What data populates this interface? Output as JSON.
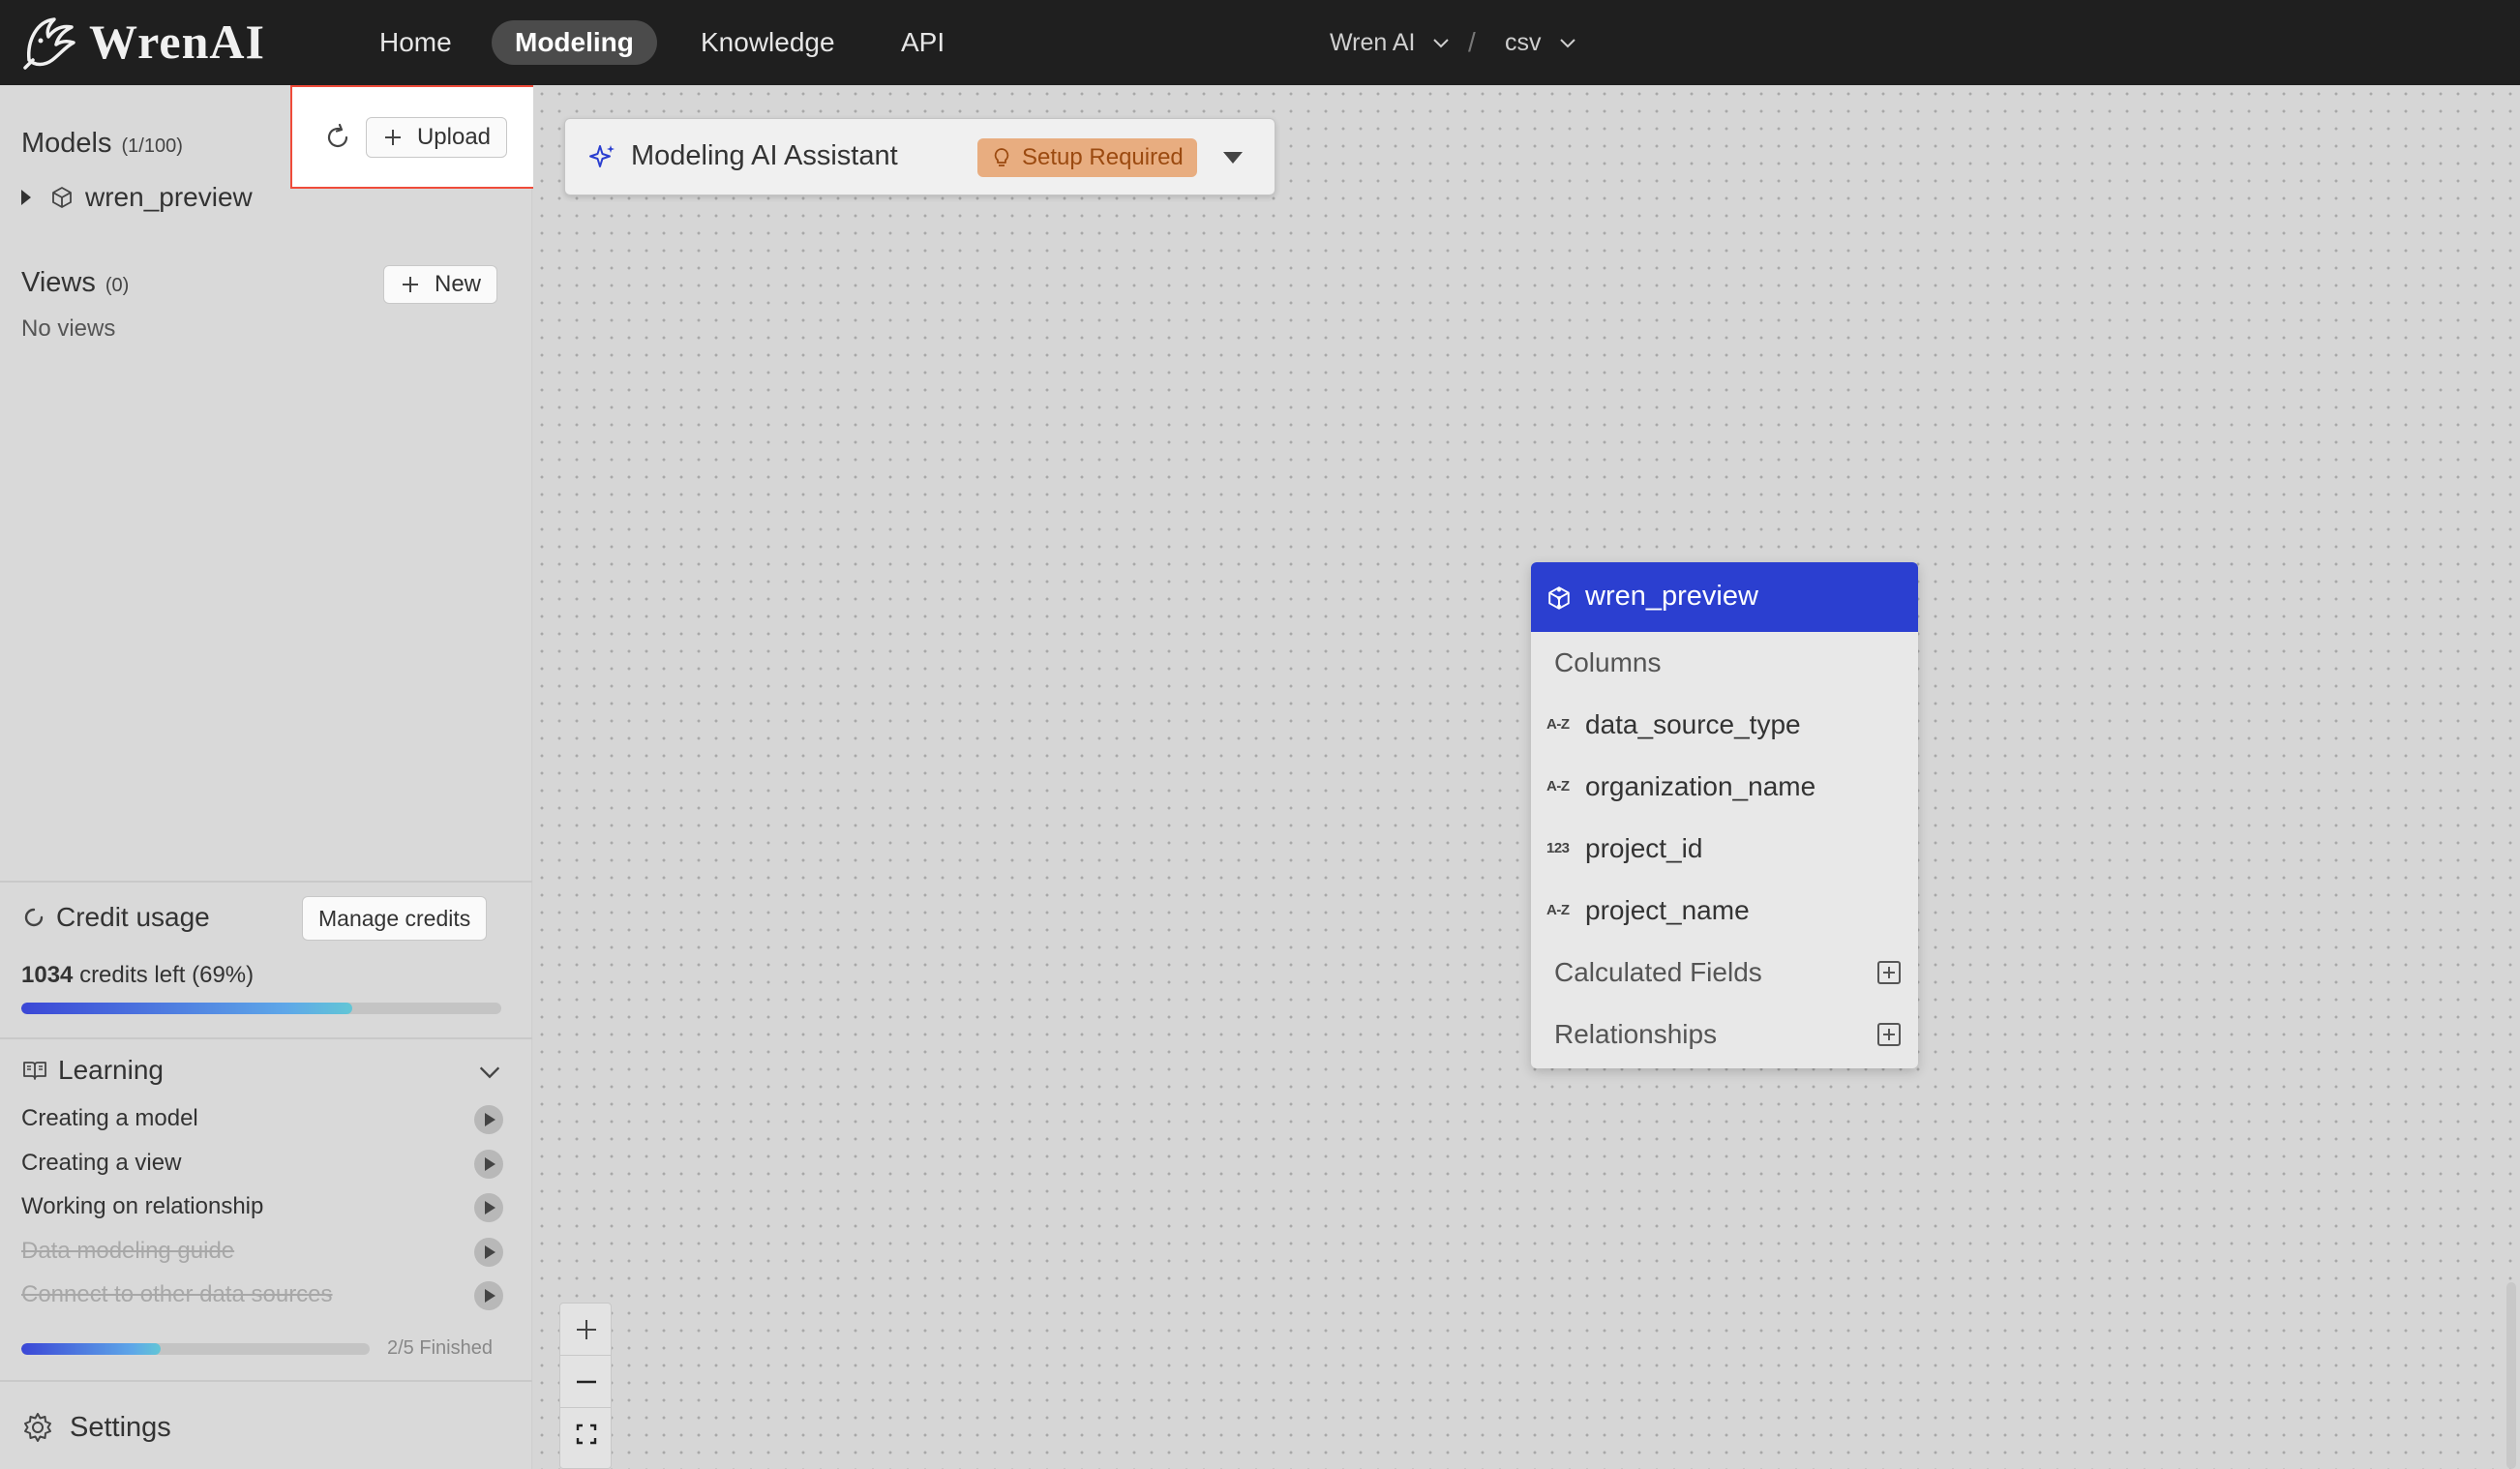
{
  "app": {
    "brand": "WrenAI",
    "nav": [
      "Home",
      "Modeling",
      "Knowledge",
      "API"
    ],
    "active_nav": "Modeling",
    "breadcrumb": {
      "project": "Wren AI",
      "source": "csv"
    }
  },
  "sidebar": {
    "models": {
      "title": "Models",
      "count": "(1/100)",
      "items": [
        "wren_preview"
      ]
    },
    "toolbox": {
      "upload_label": "Upload"
    },
    "views": {
      "title": "Views",
      "count": "(0)",
      "new_label": "New",
      "empty_text": "No views"
    },
    "credits": {
      "title": "Credit usage",
      "manage_label": "Manage credits",
      "amount": "1034",
      "suffix": "credits left (69%)",
      "percent": 69
    },
    "learning": {
      "title": "Learning",
      "items": [
        {
          "label": "Creating a model",
          "done": false
        },
        {
          "label": "Creating a view",
          "done": false
        },
        {
          "label": "Working on relationship",
          "done": false
        },
        {
          "label": "Data modeling guide",
          "done": true
        },
        {
          "label": "Connect to other data sources",
          "done": true
        }
      ],
      "progress_label": "2/5 Finished",
      "progress_fraction": 0.4
    },
    "settings_label": "Settings"
  },
  "canvas": {
    "assistant": {
      "label": "Modeling AI Assistant",
      "badge": "Setup Required"
    },
    "model_card": {
      "title": "wren_preview",
      "columns_label": "Columns",
      "columns": [
        {
          "type": "A-Z",
          "name": "data_source_type"
        },
        {
          "type": "A-Z",
          "name": "organization_name"
        },
        {
          "type": "123",
          "name": "project_id"
        },
        {
          "type": "A-Z",
          "name": "project_name"
        }
      ],
      "calculated_fields_label": "Calculated Fields",
      "relationships_label": "Relationships"
    }
  },
  "colors": {
    "topbar": "#1f1f1f",
    "accent": "#2b3fd0",
    "badge_bg": "#e8ad80",
    "highlight_border": "#ef4b3a"
  }
}
